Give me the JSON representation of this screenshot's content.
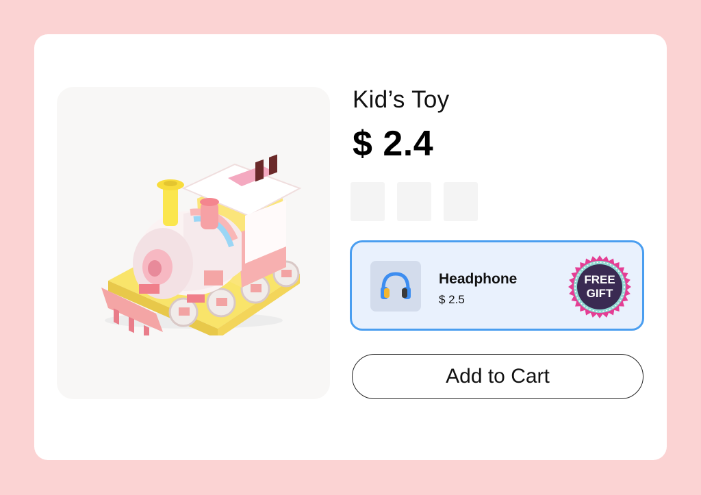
{
  "product": {
    "title": "Kid’s Toy",
    "price": "$ 2.4",
    "image_icon": "toy-train-icon",
    "thumbnail_count": 3
  },
  "gift": {
    "name": "Headphone",
    "price": "$ 2.5",
    "icon": "headphone-icon",
    "badge_line1": "FREE",
    "badge_line2": "GIFT"
  },
  "actions": {
    "add_to_cart_label": "Add to Cart"
  },
  "colors": {
    "background": "#fbd3d3",
    "accent_border": "#4a9ef0",
    "gift_background": "#e9f1fd",
    "badge_fill": "#3a2a52",
    "badge_ring": "#e43e94"
  }
}
